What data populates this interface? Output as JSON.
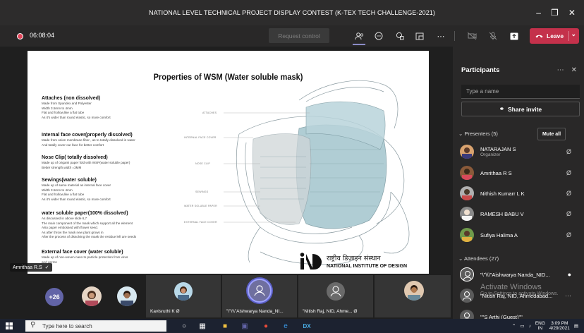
{
  "window": {
    "title": "NATIONAL LEVEL TECHNICAL PROJECT DISPLAY CONTEST (K-TEX TECH CHALLENGE-2021)"
  },
  "toolbar": {
    "timer": "06:08:04",
    "request_control": "Request control",
    "leave": "Leave"
  },
  "slide": {
    "title": "Properties of WSM (Water soluble mask)",
    "sections": [
      {
        "heading": "Attaches (non dissolved)",
        "lines": [
          "Made from Spandex and Polyester",
          "Width 3.5mm to 4mm",
          "Flat and hollow,like a flat tube",
          "As it's wider than round elastic, so more comfort"
        ]
      },
      {
        "heading": "Internal face cover(properly dissolved)",
        "lines": [
          "Made from onion membrane fiber , as to totally dissolved in water",
          "And totally cover our face for better comfort"
        ]
      },
      {
        "heading": "Nose Clip( totally dissolved)",
        "lines": [
          "Made up of origami paper fold with WSP(water soluble paper)",
          "Better strength,width =3MM"
        ]
      },
      {
        "heading": "Sewings(water soluble)",
        "lines": [
          "Made up of same material as internal face cover",
          "Width 3.5mm to 4mm",
          "Flat and hollow,like a flat tube",
          "As it's wider than round elastic, so more comfort"
        ]
      },
      {
        "heading": "water soluble paper(100% dissolved)",
        "lines": [
          "As discussed in above slide 6,7",
          "The main component of the mask which support all the element",
          "Also paper embossed with flower seed.",
          "As after throw the mask new plant grows in",
          "After the process of dissolving the mask the residue left are seeds"
        ]
      },
      {
        "heading": "External face cover (water soluble)",
        "lines": [
          "Made up of non-woven nano to particle protection from virus",
          "and germs"
        ]
      }
    ],
    "diagram_labels": [
      "ATTACHES",
      "INTERNAL FACE COVER",
      "NOSE CLIP",
      "SEWINGS",
      "WATER SOLUBLE PAPER",
      "EXTERNAL FACE COVER"
    ],
    "logo_hindi": "राष्ट्रीय डिज़ाइन संस्थान",
    "logo_english": "NATIONAL INSTITUTE OF DESIGN",
    "presenter": "Amrithaa R.S"
  },
  "panel": {
    "title": "Participants",
    "search_placeholder": "Type a name",
    "share_invite": "Share invite",
    "presenters_label": "Presenters (5)",
    "mute_all": "Mute all",
    "presenters": [
      {
        "name": "NATARAJAN S",
        "role": "Organizer",
        "color": "#d9a36f"
      },
      {
        "name": "Amrithaa R S",
        "role": "",
        "color": "#c97a52"
      },
      {
        "name": "Nithish Kumarr L K",
        "role": "",
        "color": "#b0b0b0"
      },
      {
        "name": "RAMESH BABU V",
        "role": "",
        "color": "#8a8a8a"
      },
      {
        "name": "Sufiya Halima A",
        "role": "",
        "color": "#6f9a4b"
      }
    ],
    "attendees_label": "Attendees (27)",
    "attendees": [
      {
        "name": "\"\\\"\\\\\\\"Aishwarya Nanda_NID..."
      },
      {
        "name": "\"Nitish Raj, NID, Ahmedabad..."
      },
      {
        "name": "\"\"S Arthi (Guest)\"\""
      }
    ]
  },
  "gallery": {
    "more": "+26",
    "tiles": [
      {
        "label": "Kavisruthi K"
      },
      {
        "label": "\"\\\"\\\\\\\"Aishwarya Nanda_NI..."
      },
      {
        "label": "\"Nitish Raj, NID, Ahme..."
      }
    ]
  },
  "watermark": {
    "line1": "Activate Windows",
    "line2": "Go to Settings to activate Windows."
  },
  "taskbar": {
    "search_placeholder": "Type here to search",
    "lang1": "ENG",
    "lang2": "IN",
    "time": "3:09 PM",
    "date": "4/29/2021"
  }
}
